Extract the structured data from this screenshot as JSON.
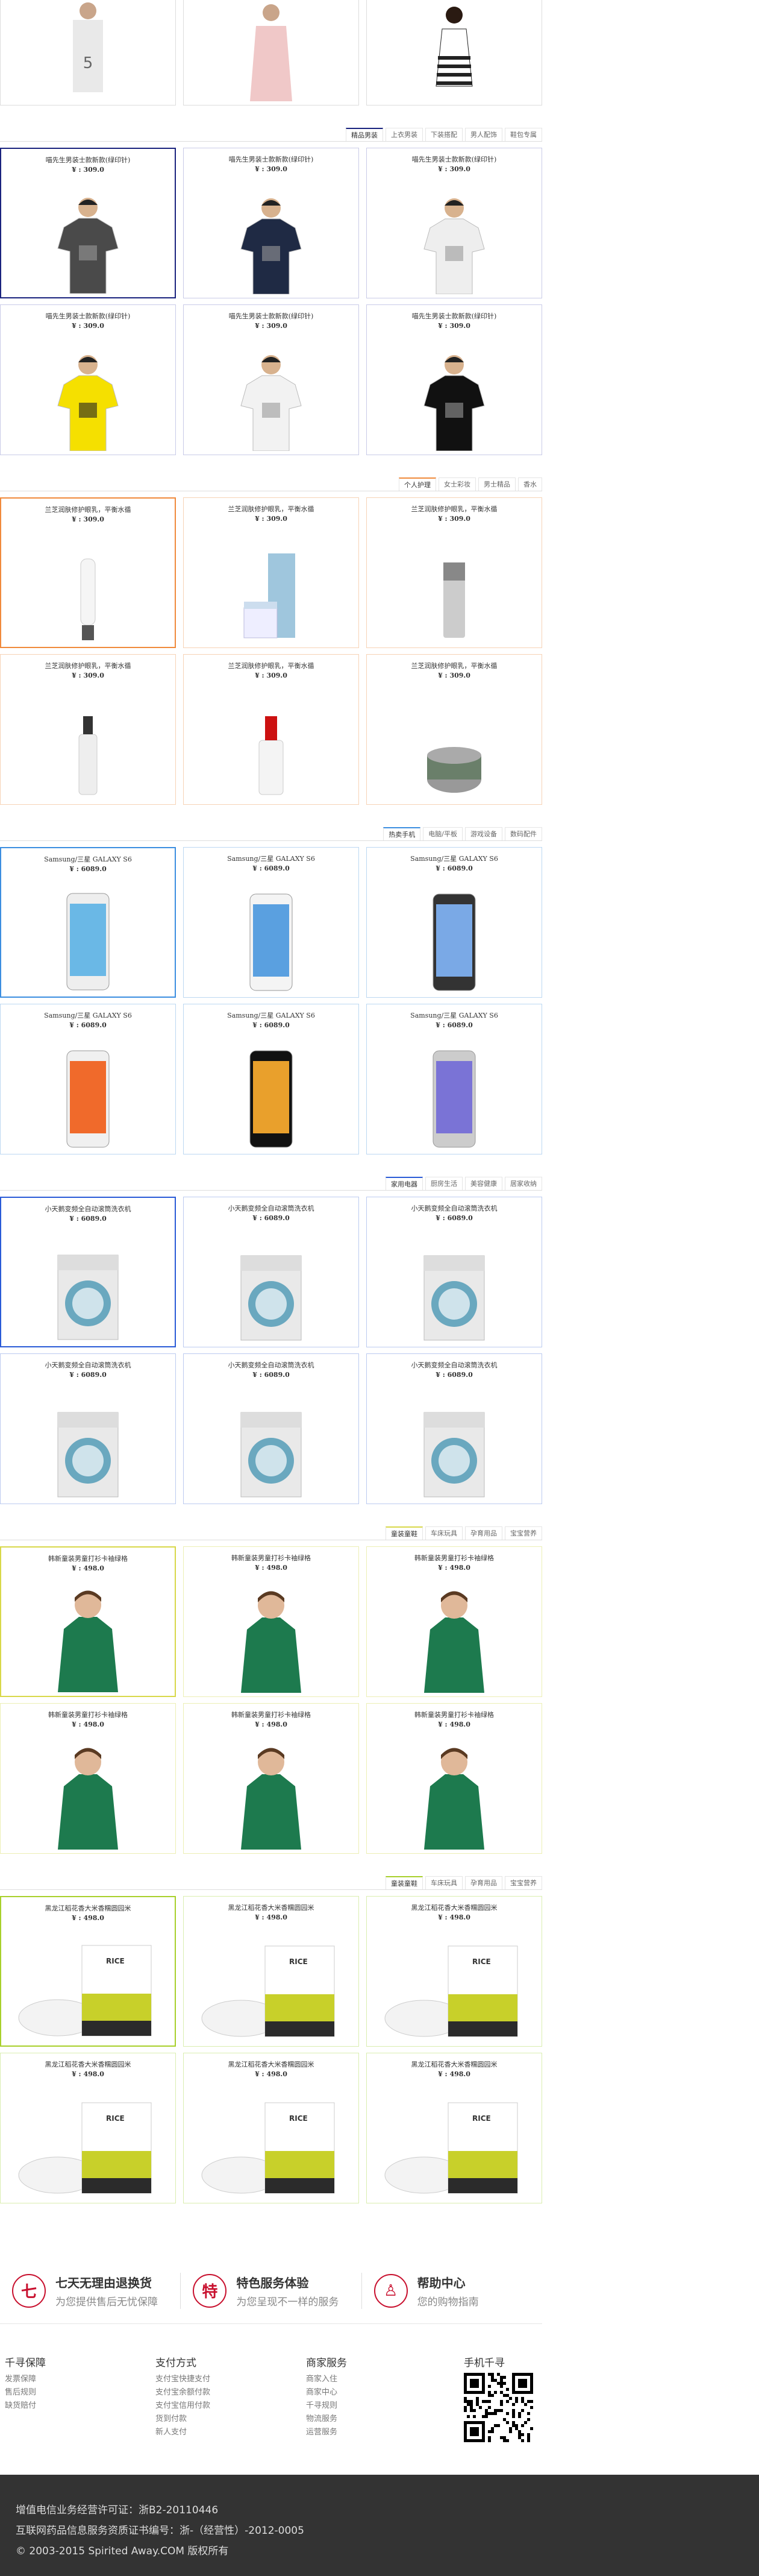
{
  "sections": [
    {
      "id": "women",
      "tabs": [],
      "color": "#ccc",
      "color2": "#ddd"
    },
    {
      "id": "men",
      "tabs": [
        "精品男装",
        "上衣男装",
        "下装搭配",
        "男人配饰",
        "鞋包专属"
      ],
      "color": "#1a237e",
      "color2": "#c9cbe8",
      "items": [
        {
          "name": "喵先生男装士款新款(绿印针)",
          "price": "¥ : 309.0"
        },
        {
          "name": "喵先生男装士款新款(绿印针)",
          "price": "¥ : 309.0"
        },
        {
          "name": "喵先生男装士款新款(绿印针)",
          "price": "¥ : 309.0"
        },
        {
          "name": "喵先生男装士款新款(绿印针)",
          "price": "¥ : 309.0"
        },
        {
          "name": "喵先生男装士款新款(绿印针)",
          "price": "¥ : 309.0"
        },
        {
          "name": "喵先生男装士款新款(绿印针)",
          "price": "¥ : 309.0"
        }
      ]
    },
    {
      "id": "beauty",
      "tabs": [
        "个人护理",
        "女士彩妆",
        "男士精品",
        "香水"
      ],
      "color": "#f08a3c",
      "color2": "#f7d3b6",
      "items": [
        {
          "name": "兰芝润肤修护眼乳，平衡水循",
          "price": "¥ : 309.0"
        },
        {
          "name": "兰芝润肤修护眼乳，平衡水循",
          "price": "¥ : 309.0"
        },
        {
          "name": "兰芝润肤修护眼乳，平衡水循",
          "price": "¥ : 309.0"
        },
        {
          "name": "兰芝润肤修护眼乳，平衡水循",
          "price": "¥ : 309.0"
        },
        {
          "name": "兰芝润肤修护眼乳，平衡水循",
          "price": "¥ : 309.0"
        },
        {
          "name": "兰芝润肤修护眼乳，平衡水循",
          "price": "¥ : 309.0"
        }
      ]
    },
    {
      "id": "phone",
      "tabs": [
        "热卖手机",
        "电脑/平板",
        "游戏设备",
        "数码配件"
      ],
      "color": "#3c8ee0",
      "color2": "#bcd8f2",
      "items": [
        {
          "name": "Samsung/三星 GALAXY S6",
          "price": "¥ : 6089.0"
        },
        {
          "name": "Samsung/三星 GALAXY S6",
          "price": "¥ : 6089.0"
        },
        {
          "name": "Samsung/三星 GALAXY S6",
          "price": "¥ : 6089.0"
        },
        {
          "name": "Samsung/三星 GALAXY S6",
          "price": "¥ : 6089.0"
        },
        {
          "name": "Samsung/三星 GALAXY S6",
          "price": "¥ : 6089.0"
        },
        {
          "name": "Samsung/三星 GALAXY S6",
          "price": "¥ : 6089.0"
        }
      ]
    },
    {
      "id": "appliance",
      "tabs": [
        "家用电器",
        "厨房生活",
        "美容健康",
        "居家收纳"
      ],
      "color": "#2a5bd7",
      "color2": "#bccbf0",
      "items": [
        {
          "name": "小天鹅变频全自动滚筒洗衣机",
          "price": "¥ : 6089.0"
        },
        {
          "name": "小天鹅变频全自动滚筒洗衣机",
          "price": "¥ : 6089.0"
        },
        {
          "name": "小天鹅变频全自动滚筒洗衣机",
          "price": "¥ : 6089.0"
        },
        {
          "name": "小天鹅变频全自动滚筒洗衣机",
          "price": "¥ : 6089.0"
        },
        {
          "name": "小天鹅变频全自动滚筒洗衣机",
          "price": "¥ : 6089.0"
        },
        {
          "name": "小天鹅变频全自动滚筒洗衣机",
          "price": "¥ : 6089.0"
        }
      ]
    },
    {
      "id": "kids",
      "tabs": [
        "童装童鞋",
        "车床玩具",
        "孕育用品",
        "宝宝营养"
      ],
      "color": "#d8d84a",
      "color2": "#ecefb4",
      "items": [
        {
          "name": "韩新童装男童打衫卡袖绿格",
          "price": "¥ : 498.0"
        },
        {
          "name": "韩新童装男童打衫卡袖绿格",
          "price": "¥ : 498.0"
        },
        {
          "name": "韩新童装男童打衫卡袖绿格",
          "price": "¥ : 498.0"
        },
        {
          "name": "韩新童装男童打衫卡袖绿格",
          "price": "¥ : 498.0"
        },
        {
          "name": "韩新童装男童打衫卡袖绿格",
          "price": "¥ : 498.0"
        },
        {
          "name": "韩新童装男童打衫卡袖绿格",
          "price": "¥ : 498.0"
        }
      ]
    },
    {
      "id": "food",
      "tabs": [
        "童装童鞋",
        "车床玩具",
        "孕育用品",
        "宝宝营养"
      ],
      "color": "#a8d02c",
      "color2": "#daeeb0",
      "items": [
        {
          "name": "黑龙江稻花香大米香糯圆园米",
          "price": "¥ : 498.0"
        },
        {
          "name": "黑龙江稻花香大米香糯圆园米",
          "price": "¥ : 498.0"
        },
        {
          "name": "黑龙江稻花香大米香糯圆园米",
          "price": "¥ : 498.0"
        },
        {
          "name": "黑龙江稻花香大米香糯圆园米",
          "price": "¥ : 498.0"
        },
        {
          "name": "黑龙江稻花香大米香糯圆园米",
          "price": "¥ : 498.0"
        },
        {
          "name": "黑龙江稻花香大米香糯圆园米",
          "price": "¥ : 498.0"
        }
      ]
    }
  ],
  "services": [
    {
      "glyph": "七",
      "title": "七天无理由退换货",
      "sub": "为您提供售后无忧保障"
    },
    {
      "glyph": "特",
      "title": "特色服务体验",
      "sub": "为您呈现不一样的服务"
    },
    {
      "glyph": "♙",
      "title": "帮助中心",
      "sub": "您的购物指南"
    }
  ],
  "footer_links": [
    {
      "title": "千寻保障",
      "links": [
        "发票保障",
        "售后规则",
        "缺货赔付"
      ]
    },
    {
      "title": "支付方式",
      "links": [
        "支付宝快捷支付",
        "支付宝余额付款",
        "支付宝信用付款",
        "货到付款",
        "新人支付"
      ]
    },
    {
      "title": "商家服务",
      "links": [
        "商家入住",
        "商家中心",
        "千寻规则",
        "物流服务",
        "运营服务"
      ]
    }
  ],
  "qr_title": "手机千寻",
  "bottom": {
    "line1": "增值电信业务经营许可证：浙B2-20110446",
    "line2": "互联网药品信息服务资质证书编号：浙-（经营性）-2012-0005",
    "line3": "© 2003-2015 Spirited Away.COM 版权所有"
  }
}
